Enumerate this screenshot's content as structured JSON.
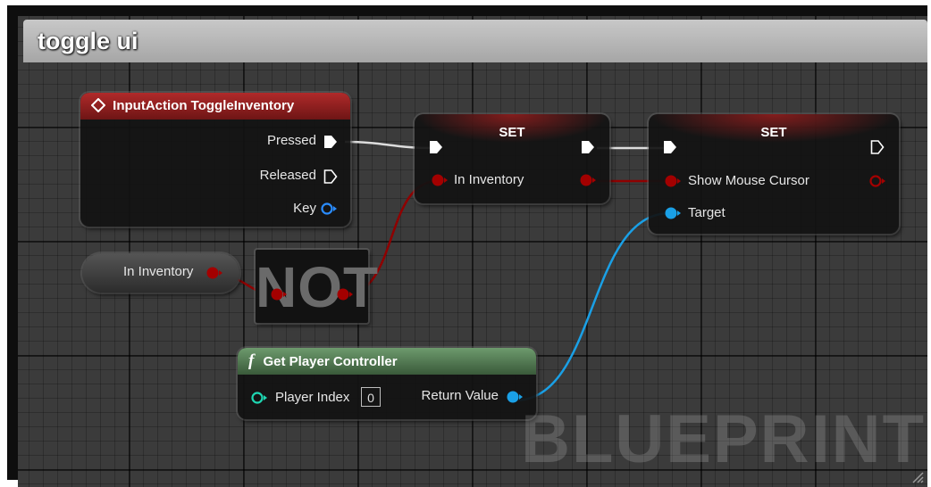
{
  "comment": {
    "title": "toggle ui"
  },
  "input_action_node": {
    "title": "InputAction ToggleInventory",
    "pins": {
      "pressed": "Pressed",
      "released": "Released",
      "key": "Key"
    }
  },
  "set_node_1": {
    "title": "SET",
    "pin": "In Inventory"
  },
  "set_node_2": {
    "title": "SET",
    "pin": "Show Mouse Cursor",
    "target": "Target"
  },
  "in_inventory_getter": {
    "label": "In Inventory"
  },
  "not_node": {
    "label": "NOT"
  },
  "get_player_controller_node": {
    "icon": "f",
    "title": "Get Player Controller",
    "player_index_label": "Player Index",
    "player_index_value": "0",
    "return_value_label": "Return Value"
  },
  "watermark": "BLUEPRINT",
  "colors": {
    "exec": "#ffffff",
    "bool_pin": "#a30000",
    "object_pin": "#1aa0e6",
    "int_pin": "#1ed6b2",
    "event_header": "#8e1e1e",
    "function_header": "#4f7a4f"
  }
}
